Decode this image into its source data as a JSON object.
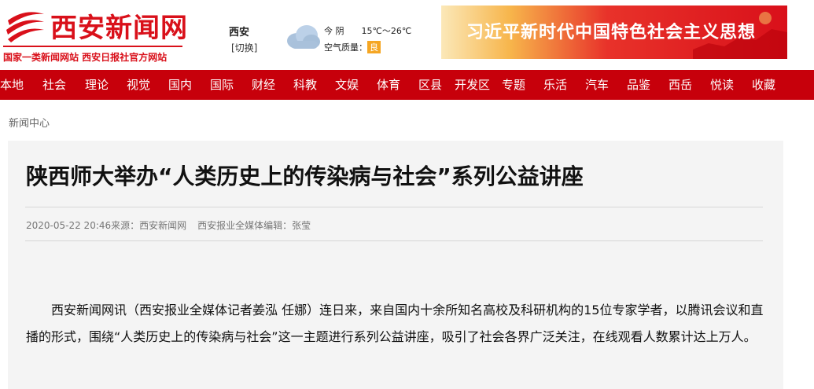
{
  "site": {
    "name": "西安新闻网",
    "slogan": "国家一类新闻网站 西安日报社官方网站",
    "brand_color": "#d9101a"
  },
  "weather": {
    "city": "西安",
    "switch_label": "[切换]",
    "day": "今 阴",
    "temp": "15℃～26℃",
    "aqi_label": "空气质量：",
    "aqi_value": "良",
    "icon": "cloud-icon"
  },
  "banner": {
    "text": "习近平新时代中国特色社会主义思想"
  },
  "nav": {
    "color": "#c7000b",
    "items": [
      "本地",
      "社会",
      "理论",
      "视觉",
      "国内",
      "国际",
      "财经",
      "科教",
      "文娱",
      "体育",
      "区县",
      "开发区",
      "专题",
      "乐活",
      "汽车",
      "品鉴",
      "西岳",
      "悦读",
      "收藏"
    ]
  },
  "breadcrumb": "新闻中心",
  "article": {
    "title": "陕西师大举办“人类历史上的传染病与社会”系列公益讲座",
    "datetime": "2020-05-22 20:46",
    "source": "来源：西安新闻网",
    "editor": "西安报业全媒体编辑：张莹",
    "body": "西安新闻网讯（西安报业全媒体记者姜泓 任娜）连日来，来自国内十余所知名高校及科研机构的15位专家学者，以腾讯会议和直播的形式，围绕“人类历史上的传染病与社会”这一主题进行系列公益讲座，吸引了社会各界广泛关注，在线观看人数累计达上万人。"
  }
}
